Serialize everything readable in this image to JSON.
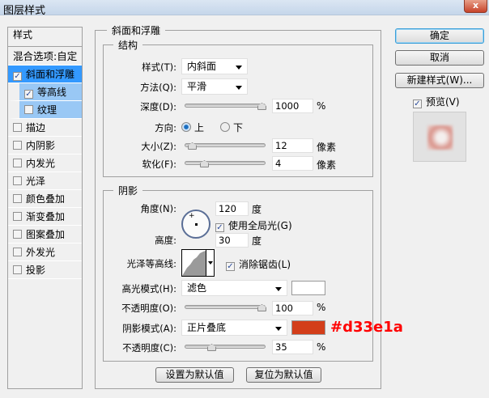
{
  "window": {
    "title": "图层样式",
    "close_label": "x"
  },
  "sidebar": {
    "header": "样式",
    "blending": "混合选项:自定",
    "items": [
      {
        "label": "斜面和浮雕",
        "checked": true,
        "selected": true
      },
      {
        "label": "等高线",
        "checked": true,
        "sub": true
      },
      {
        "label": "纹理",
        "checked": false,
        "sub": true
      },
      {
        "label": "描边",
        "checked": false
      },
      {
        "label": "内阴影",
        "checked": false
      },
      {
        "label": "内发光",
        "checked": false
      },
      {
        "label": "光泽",
        "checked": false
      },
      {
        "label": "颜色叠加",
        "checked": false
      },
      {
        "label": "渐变叠加",
        "checked": false
      },
      {
        "label": "图案叠加",
        "checked": false
      },
      {
        "label": "外发光",
        "checked": false
      },
      {
        "label": "投影",
        "checked": false
      }
    ]
  },
  "bevel": {
    "title": "斜面和浮雕",
    "structure": {
      "title": "结构",
      "style_label": "样式(T):",
      "style_value": "内斜面",
      "technique_label": "方法(Q):",
      "technique_value": "平滑",
      "depth_label": "深度(D):",
      "depth_value": "1000",
      "depth_unit": "%",
      "depth_fraction": 1.0,
      "direction_label": "方向:",
      "dir_up": "上",
      "dir_down": "下",
      "direction": "up",
      "size_label": "大小(Z):",
      "size_value": "12",
      "size_unit": "像素",
      "size_fraction": 0.06,
      "soften_label": "软化(F):",
      "soften_value": "4",
      "soften_unit": "像素",
      "soften_fraction": 0.25
    },
    "shading": {
      "title": "阴影",
      "angle_label": "角度(N):",
      "angle_value": "120",
      "angle_unit": "度",
      "global_light_label": "使用全局光(G)",
      "global_light": true,
      "altitude_label": "高度:",
      "altitude_value": "30",
      "altitude_unit": "度",
      "gloss_label": "光泽等高线:",
      "antialias_label": "消除锯齿(L)",
      "antialias": true,
      "highlight_label": "高光模式(H):",
      "highlight_value": "滤色",
      "highlight_color": "#ffffff",
      "hl_opacity_label": "不透明度(O):",
      "hl_opacity_value": "100",
      "hl_opacity_fraction": 1.0,
      "shadow_label": "阴影模式(A):",
      "shadow_value": "正片叠底",
      "shadow_color": "#d33e1a",
      "shadow_annotation": "#d33e1a",
      "sh_opacity_label": "不透明度(C):",
      "sh_opacity_value": "35",
      "sh_opacity_fraction": 0.35,
      "pct": "%"
    },
    "make_default": "设置为默认值",
    "reset_default": "复位为默认值"
  },
  "actions": {
    "ok": "确定",
    "cancel": "取消",
    "new_style": "新建样式(W)...",
    "preview_label": "预览(V)",
    "preview": true
  }
}
